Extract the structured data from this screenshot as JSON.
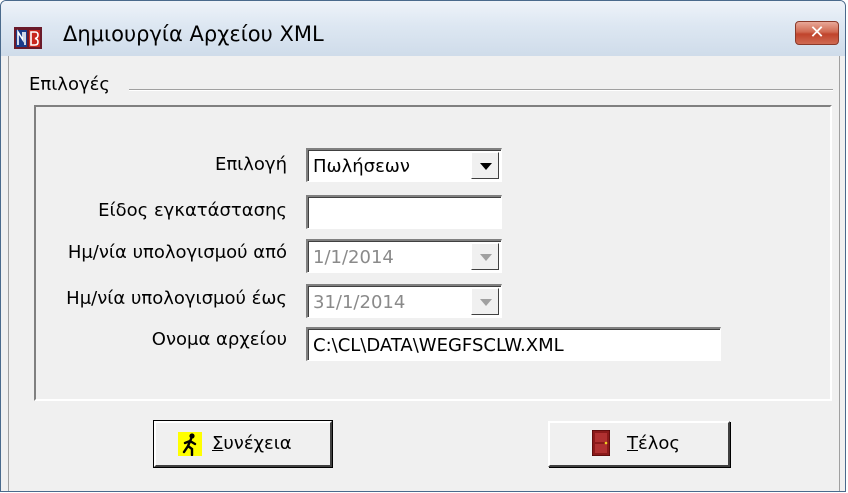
{
  "window": {
    "title": "Δημιουργία Αρχείου XML",
    "close_glyph": "✕",
    "app_icon": "nb-app-icon"
  },
  "group": {
    "label": "Επιλογές"
  },
  "form": {
    "epilogi": {
      "label": "Επιλογή",
      "value": "Πωλήσεων"
    },
    "eidos": {
      "label": "Είδος εγκατάστασης",
      "value": ""
    },
    "date_from": {
      "label": "Ημ/νία υπολογισμού από",
      "value": "1/1/2014"
    },
    "date_to": {
      "label": "Ημ/νία υπολογισμού έως",
      "value": "31/1/2014"
    },
    "filename": {
      "label": "Ονομα αρχείου",
      "value": "C:\\CL\\DATA\\WEGFSCLW.XML"
    }
  },
  "buttons": {
    "continue": {
      "mnemonic": "Σ",
      "rest": "υνέχεια",
      "icon": "walking-person-icon"
    },
    "end": {
      "mnemonic": "Τ",
      "rest": "έλος",
      "icon": "door-icon"
    }
  }
}
